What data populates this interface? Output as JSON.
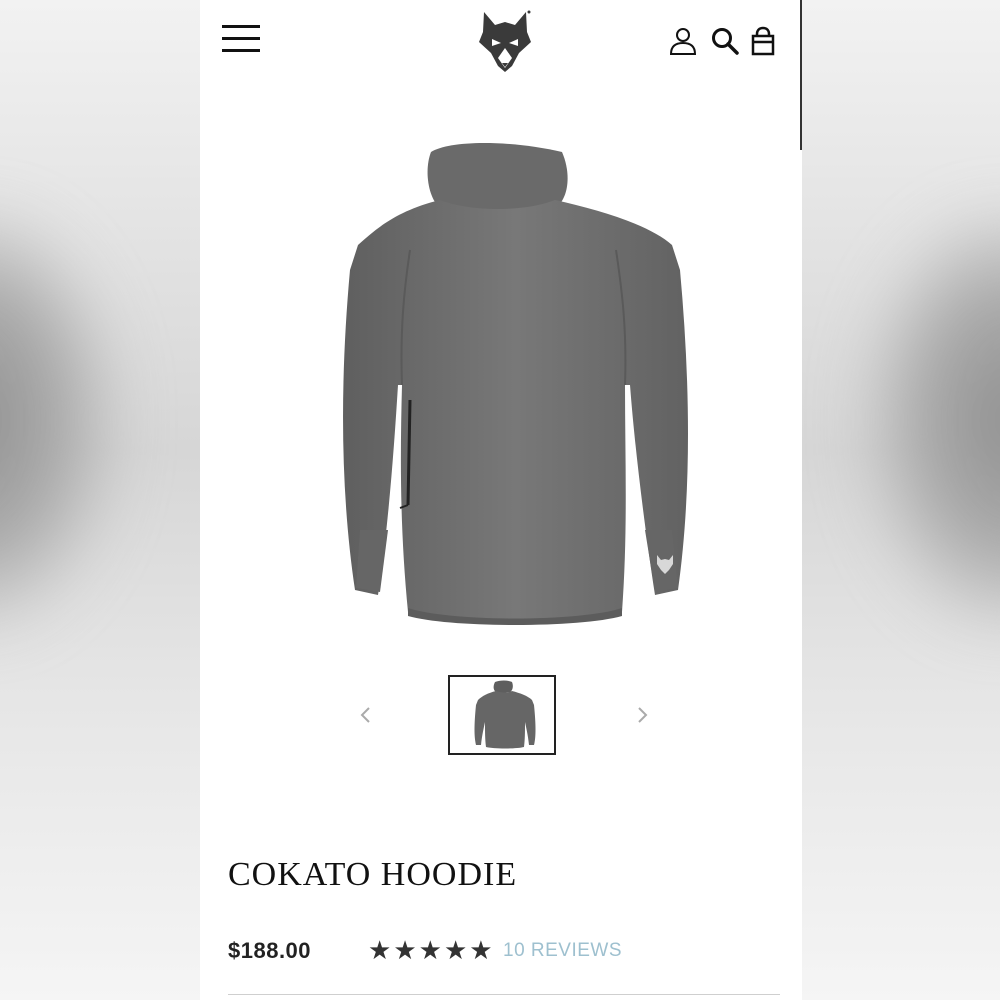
{
  "header": {
    "menu_icon": "hamburger-menu-icon",
    "logo_icon": "wolf-head-logo",
    "account_icon": "user-icon",
    "search_icon": "search-icon",
    "cart_icon": "shopping-bag-icon"
  },
  "gallery": {
    "main_image": "gray-hoodie-product-photo",
    "prev_icon": "chevron-left-icon",
    "next_icon": "chevron-right-icon",
    "thumbnail": "gray-hoodie-thumbnail"
  },
  "product": {
    "title": "COKATO HOODIE",
    "price": "$188.00",
    "rating": 5,
    "rating_max": 5,
    "reviews_label": "10 REVIEWS"
  },
  "colors": {
    "text": "#111111",
    "reviews_link": "#9ec0cf",
    "garment": "#6e6e6e"
  }
}
